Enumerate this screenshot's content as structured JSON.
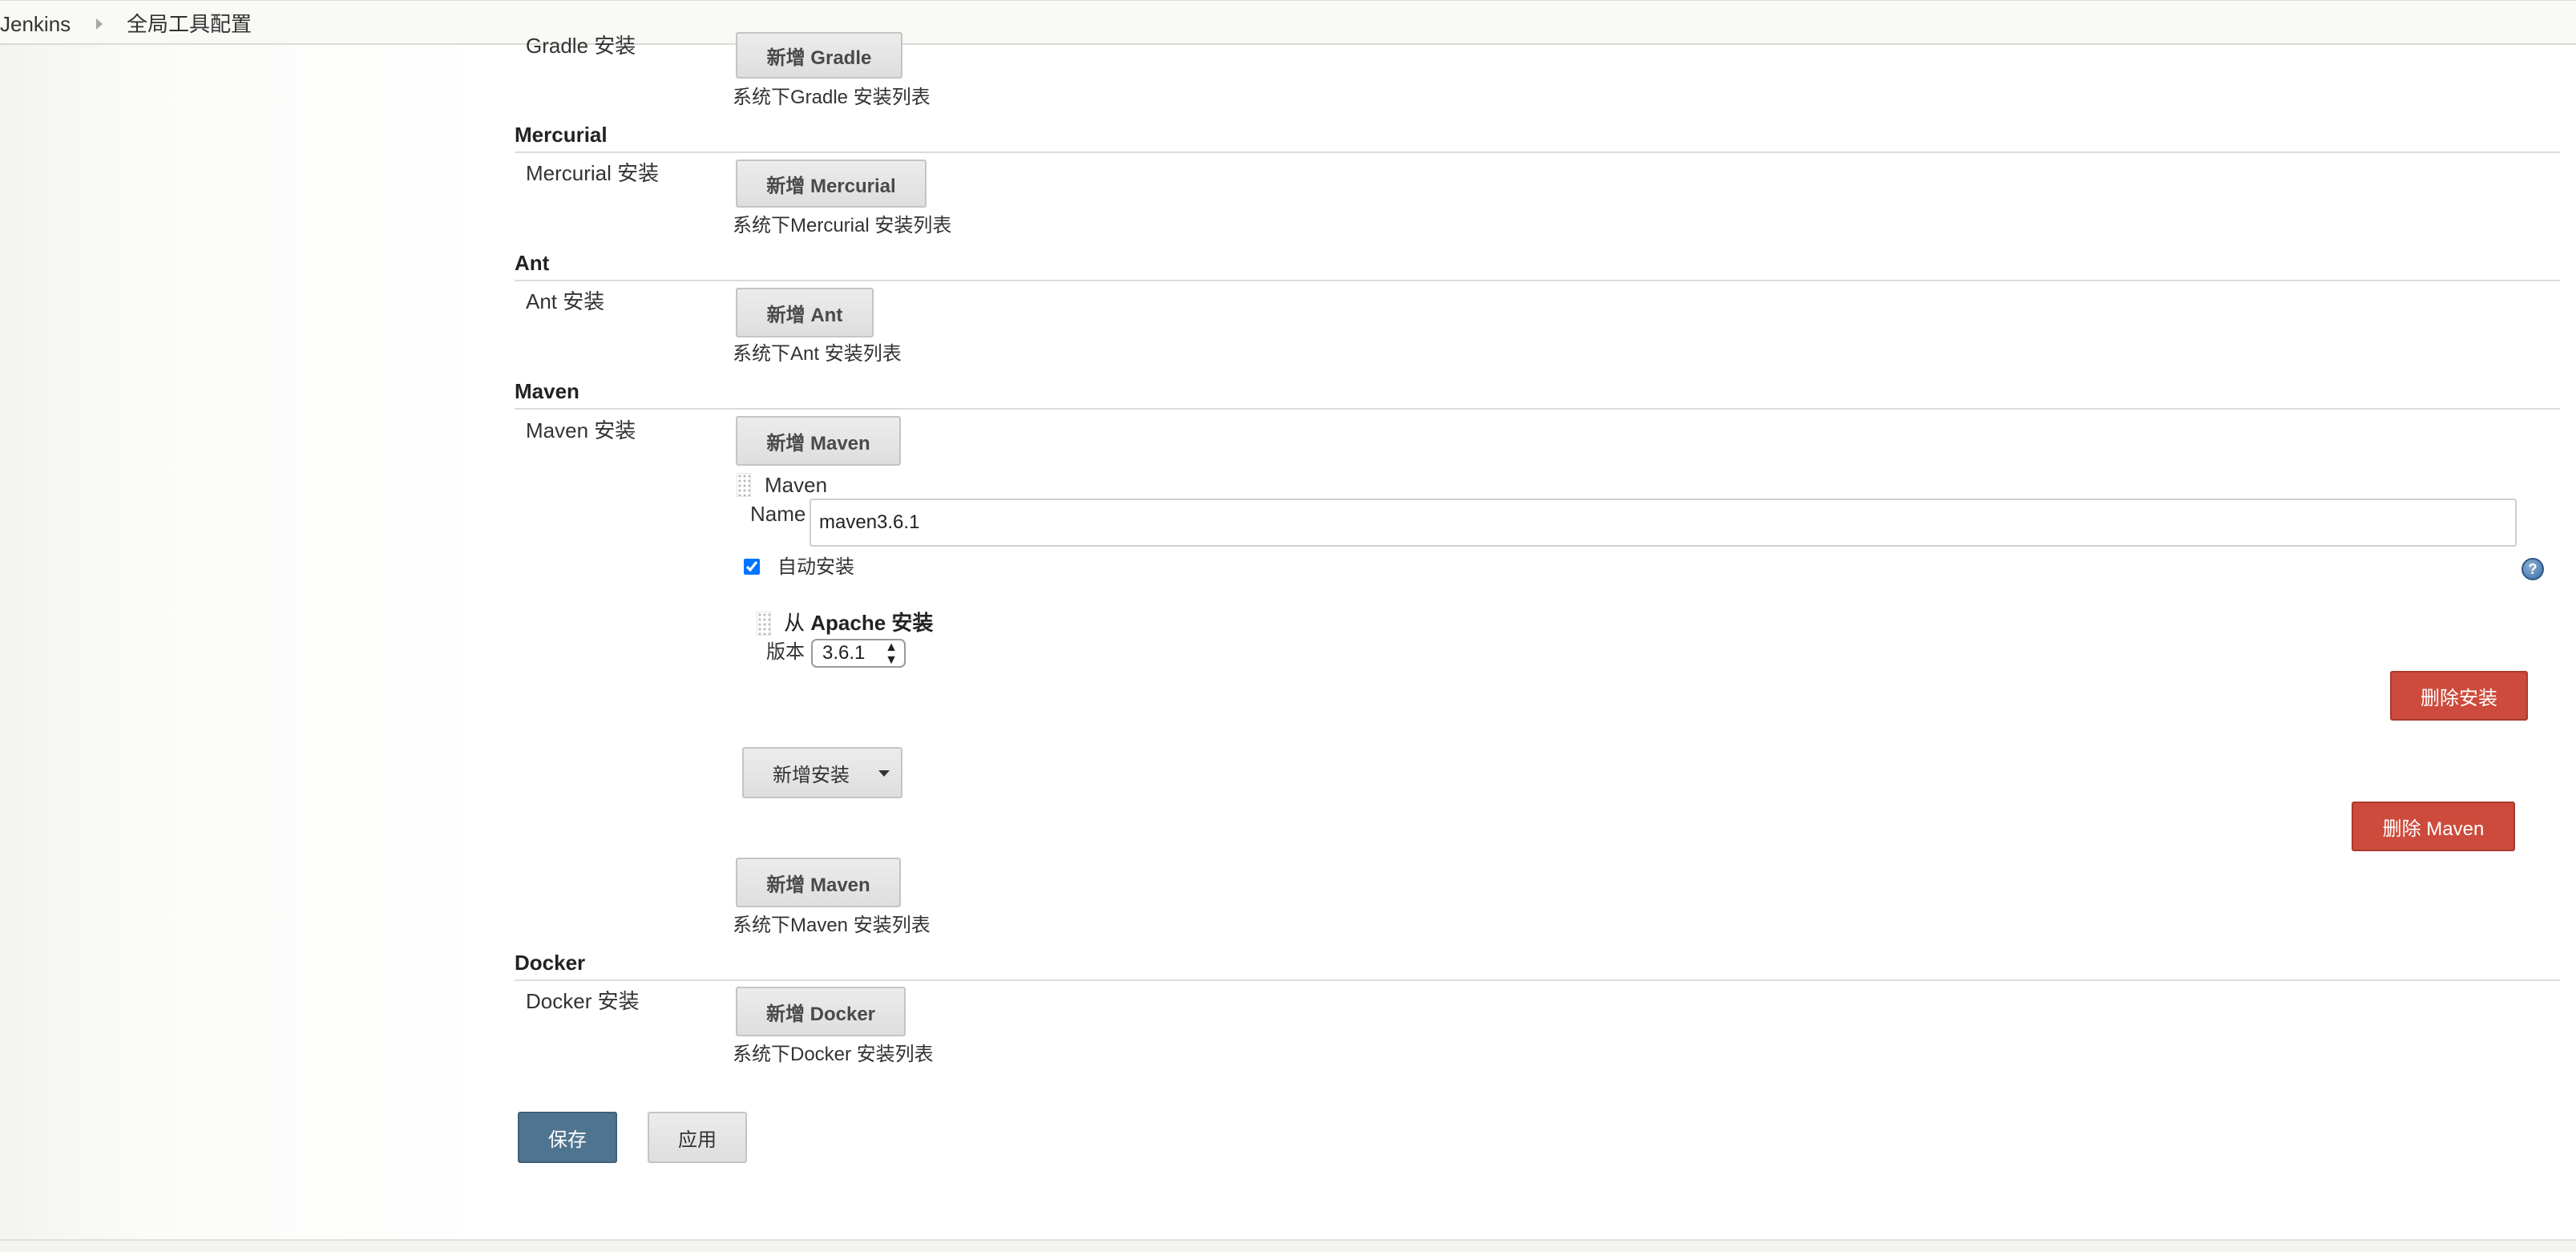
{
  "breadcrumb": {
    "home": "Jenkins",
    "current": "全局工具配置"
  },
  "gradle": {
    "section_label": "Gradle 安装",
    "add_button": "新增 Gradle",
    "description": "系统下Gradle 安装列表"
  },
  "mercurial": {
    "header": "Mercurial",
    "row_label": "Mercurial 安装",
    "add_button": "新增 Mercurial",
    "description": "系统下Mercurial 安装列表"
  },
  "ant": {
    "header": "Ant",
    "row_label": "Ant 安装",
    "add_button": "新增 Ant",
    "description": "系统下Ant 安装列表"
  },
  "maven": {
    "header": "Maven",
    "row_label": "Maven 安装",
    "add_button_top": "新增 Maven",
    "installation": {
      "title": "Maven",
      "name_label": "Name",
      "name_value": "maven3.6.1",
      "auto_install_label": "自动安装",
      "auto_install_checked": true,
      "installer_title_prefix": "从 ",
      "installer_title_bold": "Apache 安装",
      "version_label": "版本",
      "version_value": "3.6.1",
      "delete_installer_button": "删除安装",
      "add_installer_button": "新增安装",
      "delete_maven_button": "删除 Maven"
    },
    "add_button_bottom": "新增 Maven",
    "description": "系统下Maven 安装列表"
  },
  "docker": {
    "header": "Docker",
    "row_label": "Docker 安装",
    "add_button": "新增 Docker",
    "description": "系统下Docker 安装列表"
  },
  "actions": {
    "save": "保存",
    "apply": "应用"
  },
  "icons": {
    "help": "help-icon",
    "separator": "chevron-right-icon",
    "dropdown": "caret-down-icon"
  },
  "colors": {
    "danger": "#cd4b3c",
    "primary": "#4f7490",
    "help": "#3b6ba3"
  }
}
